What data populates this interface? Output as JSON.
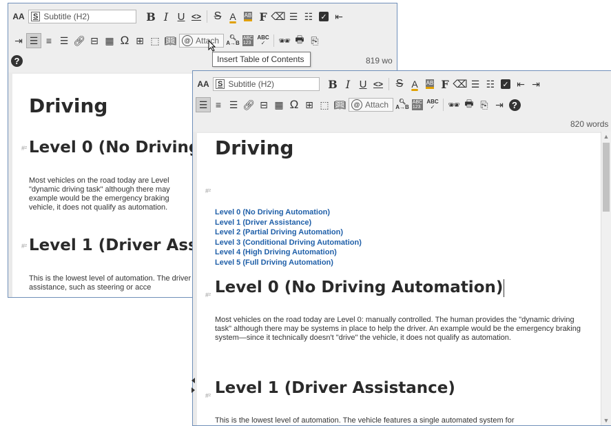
{
  "toolbar": {
    "font_size_label": "AA",
    "style_dropdown": "Subtitle (H2)",
    "bold": "B",
    "italic": "I",
    "underline": "U",
    "font_glyph": "F",
    "attach_label": "Attach",
    "abc_label": "ABC"
  },
  "back_window": {
    "word_count": "819 wo",
    "tooltip": "Insert Table of Contents",
    "title": "Driving",
    "heading_0": "Level 0 (No Driving A",
    "para_0": "Most vehicles on the road today are Level \"dynamic driving task\" although there may example would be the emergency braking vehicle, it does not qualify as automation.",
    "heading_1": "Level 1 (Driver Assis",
    "para_1": "This is the lowest level of automation. The driver assistance, such as steering or acce"
  },
  "front_window": {
    "word_count": "820 words",
    "title": "Driving",
    "toc": [
      "Level 0 (No Driving Automation)",
      "Level 1 (Driver Assistance)",
      "Level 2 (Partial Driving Automation)",
      "Level 3 (Conditional Driving Automation)",
      "Level 4 (High Driving Automation)",
      "Level 5 (Full Driving Automation)"
    ],
    "heading_0": "Level 0 (No Driving Automation)",
    "para_0": "Most vehicles on the road today are Level 0: manually controlled. The human provides the \"dynamic driving task\" although there may be systems in place to help the driver. An example would be the emergency braking system—since it technically doesn't \"drive\" the vehicle, it does not qualify as automation.",
    "heading_1": "Level 1 (Driver Assistance)",
    "para_1": "This is the lowest level of automation. The vehicle features a single automated system for"
  },
  "colors": {
    "toc_link": "#1f5fa8",
    "window_border": "#6f8fb9"
  }
}
